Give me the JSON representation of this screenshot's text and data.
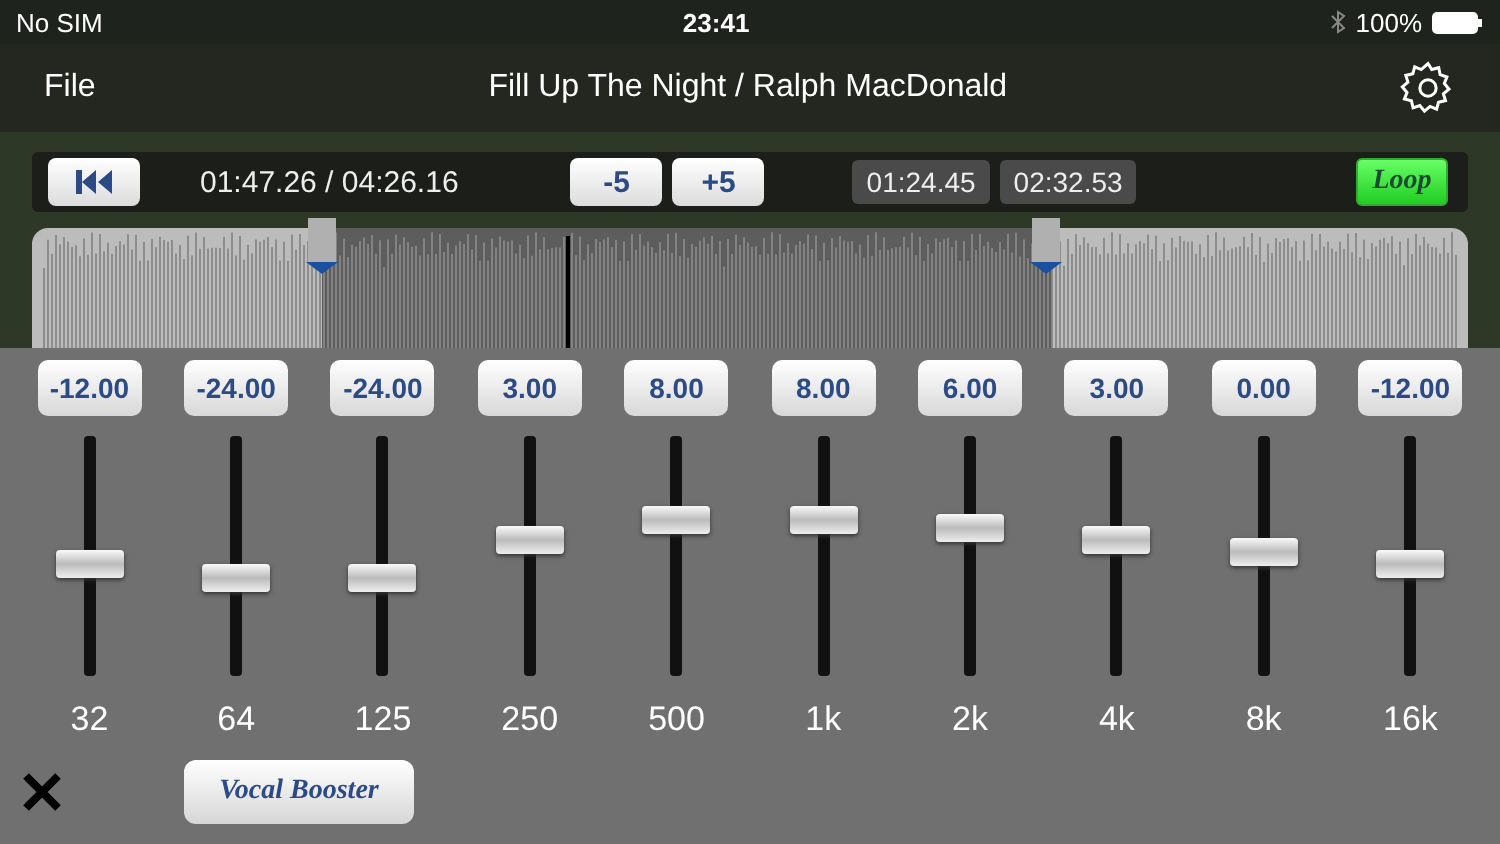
{
  "status_bar": {
    "carrier": "No SIM",
    "time": "23:41",
    "battery": "100%"
  },
  "nav": {
    "file": "File",
    "title": "Fill Up The Night / Ralph MacDonald"
  },
  "transport": {
    "position": "01:47.26 / 04:26.16",
    "back": "-5",
    "forward": "+5",
    "loop_start": "01:24.45",
    "loop_end": "02:32.53",
    "loop": {
      "label": "Loop",
      "on": true
    }
  },
  "equalizer": {
    "bands": [
      {
        "value": "-12.00",
        "label": "32",
        "level": 0.47
      },
      {
        "value": "-24.00",
        "label": "64",
        "level": 0.41
      },
      {
        "value": "-24.00",
        "label": "125",
        "level": 0.41
      },
      {
        "value": "3.00",
        "label": "250",
        "level": 0.57
      },
      {
        "value": "8.00",
        "label": "500",
        "level": 0.65
      },
      {
        "value": "8.00",
        "label": "1k",
        "level": 0.65
      },
      {
        "value": "6.00",
        "label": "2k",
        "level": 0.62
      },
      {
        "value": "3.00",
        "label": "4k",
        "level": 0.57
      },
      {
        "value": "0.00",
        "label": "8k",
        "level": 0.52
      },
      {
        "value": "-12.00",
        "label": "16k",
        "level": 0.47
      }
    ],
    "vocal_booster": {
      "label": "Vocal Booster",
      "on": false
    }
  }
}
